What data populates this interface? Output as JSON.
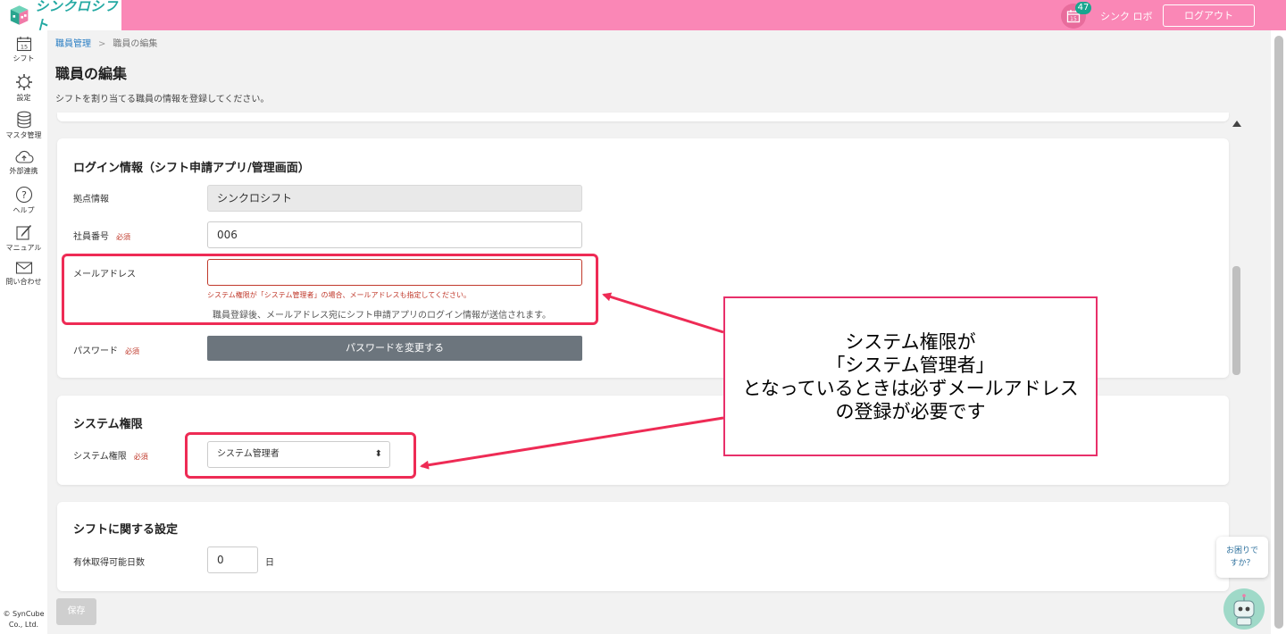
{
  "header": {
    "logo_text": "シンクロシフト",
    "calendar_day": "15",
    "notification_count": "47",
    "user_name": "シンク ロボ",
    "logout_label": "ログアウト"
  },
  "sidebar": {
    "items": [
      {
        "label": "シフト",
        "icon": "calendar-icon",
        "day": "15"
      },
      {
        "label": "設定",
        "icon": "gear-icon"
      },
      {
        "label": "マスタ管理",
        "icon": "database-icon"
      },
      {
        "label": "外部連携",
        "icon": "cloud-icon"
      },
      {
        "label": "ヘルプ",
        "icon": "question-icon"
      },
      {
        "label": "マニュアル",
        "icon": "edit-icon"
      },
      {
        "label": "問い合わせ",
        "icon": "mail-icon"
      }
    ],
    "copyright_line1": "© SynCube",
    "copyright_line2": "Co., Ltd."
  },
  "breadcrumb": {
    "parent": "職員管理",
    "separator": ">",
    "current": "職員の編集"
  },
  "page": {
    "title": "職員の編集",
    "description": "シフトを割り当てる職員の情報を登録してください。"
  },
  "login_section": {
    "title": "ログイン情報（シフト申請アプリ/管理画面）",
    "base_label": "拠点情報",
    "base_value": "シンクロシフト",
    "employee_no_label": "社員番号",
    "required_label": "必須",
    "employee_no_value": "006",
    "email_label": "メールアドレス",
    "email_value": "",
    "email_error": "システム権限が「システム管理者」の場合、メールアドレスも指定してください。",
    "email_hint": "職員登録後、メールアドレス宛にシフト申請アプリのログイン情報が送信されます。",
    "password_label": "パスワード",
    "password_button": "パスワードを変更する"
  },
  "permission_section": {
    "title": "システム権限",
    "label": "システム権限",
    "selected": "システム管理者"
  },
  "shift_section": {
    "title": "シフトに関する設定",
    "paid_leave_label": "有休取得可能日数",
    "paid_leave_value": "0",
    "paid_leave_unit": "日"
  },
  "footer": {
    "save_label": "保存"
  },
  "help": {
    "bubble_line1": "お困りで",
    "bubble_line2": "すか？"
  },
  "annotation": {
    "line1": "システム権限が",
    "line2": "「システム管理者」",
    "line3": "となっているときは必ずメールアドレス",
    "line4": "の登録が必要です"
  },
  "colors": {
    "header": "#fa87b6",
    "logo": "#24a9a3",
    "badge": "#1aa58f",
    "error": "#c0392b",
    "highlight": "#ee2b55",
    "button_gray": "#6c757d"
  }
}
